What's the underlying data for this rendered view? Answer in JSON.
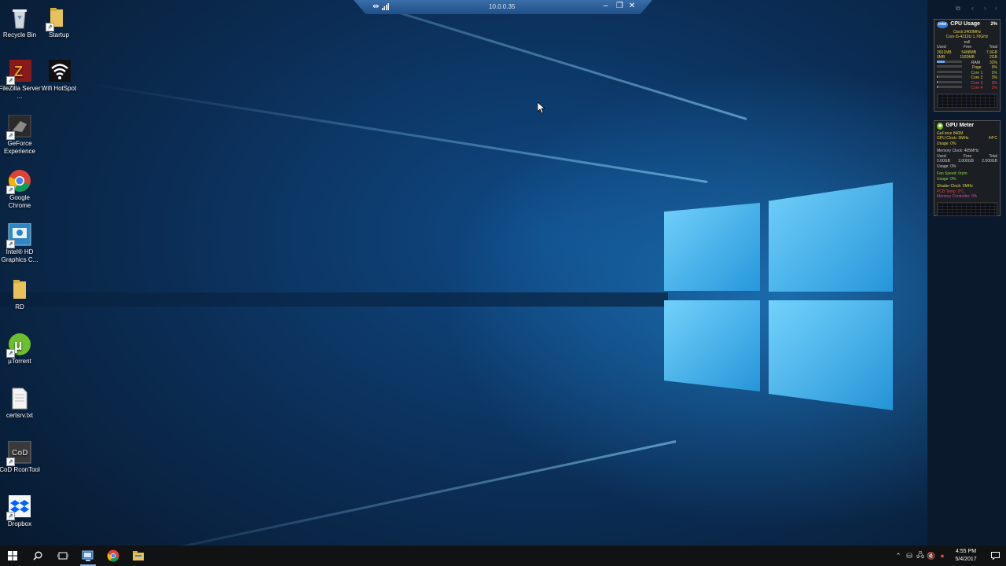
{
  "rdp": {
    "address": "10.0.0.35",
    "minimize": "–",
    "restore": "❐",
    "close": "✕"
  },
  "desktop_icons": [
    {
      "label": "Recycle Bin",
      "icon": "recycle-bin-icon"
    },
    {
      "label": "Startup",
      "icon": "folder-icon"
    },
    {
      "label": "FileZilla Server ...",
      "icon": "filezilla-icon"
    },
    {
      "label": "Wifi HotSpot",
      "icon": "wifi-icon"
    },
    {
      "label": "GeForce Experience",
      "icon": "geforce-icon"
    },
    {
      "label": "Google Chrome",
      "icon": "chrome-icon"
    },
    {
      "label": "Intel® HD Graphics C...",
      "icon": "intel-graphics-icon"
    },
    {
      "label": "RD",
      "icon": "folder-icon"
    },
    {
      "label": "µTorrent",
      "icon": "utorrent-icon"
    },
    {
      "label": "certsrv.txt",
      "icon": "text-file-icon"
    },
    {
      "label": "CoD RconTool",
      "icon": "cod-icon"
    },
    {
      "label": "Dropbox",
      "icon": "dropbox-icon"
    }
  ],
  "cpu_gadget": {
    "title": "CPU Usage",
    "percent": "2%",
    "brand": "intel",
    "clock": "Clock:2400MHz",
    "cpu": "Core i5-4210U 1.70GHz",
    "null_text": "null",
    "headers": [
      "Used",
      "Free",
      "Total"
    ],
    "used": "2601MB",
    "free": "5488MB",
    "total": "7.9GB",
    "used2": "0MB",
    "free2": "1920MB",
    "total2": "2GB",
    "rows": [
      {
        "label": "RAM",
        "value": "32%",
        "fill": 0.32
      },
      {
        "label": "Page",
        "value": "0%",
        "fill": 0.0
      },
      {
        "label": "Core 1",
        "value": "0%",
        "fill": 0.0
      },
      {
        "label": "Core 2",
        "value": "3%",
        "fill": 0.03
      },
      {
        "label": "Core 3",
        "value": "3%",
        "fill": 0.03
      },
      {
        "label": "Core 4",
        "value": "3%",
        "fill": 0.03
      }
    ]
  },
  "gpu_gadget": {
    "title": "GPU Meter",
    "model": "GeForce 840M",
    "gpu_clock": "GPU Clock: 0MHz",
    "temp": "44°C",
    "usage": "Usage: 0%",
    "memory_clock": "Memory Clock: 405MHz",
    "mem_headers": [
      "Used",
      "Free",
      "Total"
    ],
    "mem_used": "0.00GB",
    "mem_free": "2.000GB",
    "mem_total": "2.000GB",
    "mem_usage": "Usage: 0%",
    "fan_speed": "Fan Speed: 0rpm",
    "fan_usage": "Usage: 0%",
    "shader_clock": "Shader Clock: 0MHz",
    "pcb_temp": "PCB Temp: 0°C",
    "memory_controller": "Memory Controller: 0%"
  },
  "taskbar": {
    "clock_time": "4:55 PM",
    "clock_date": "5/4/2017"
  }
}
